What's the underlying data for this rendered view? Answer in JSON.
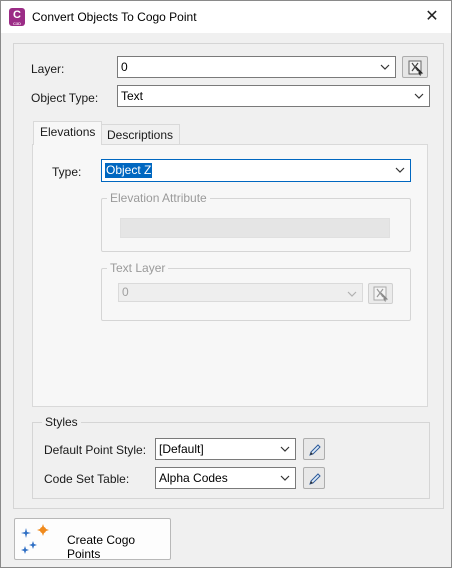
{
  "window": {
    "title": "Convert Objects To Cogo Point",
    "app_icon_letter": "C",
    "app_icon_sub": "C3D",
    "close_glyph": "✕"
  },
  "fields": {
    "layer_label": "Layer:",
    "layer_value": "0",
    "object_type_label": "Object Type:",
    "object_type_value": "Text"
  },
  "tabs": [
    {
      "label": "Elevations",
      "active": true
    },
    {
      "label": "Descriptions",
      "active": false
    }
  ],
  "elevations": {
    "type_label": "Type:",
    "type_value": "Object Z",
    "elevation_attribute_title": "Elevation Attribute",
    "text_layer_title": "Text Layer",
    "text_layer_value": "0"
  },
  "styles": {
    "title": "Styles",
    "default_point_style_label": "Default Point Style:",
    "default_point_style_value": "[Default]",
    "code_set_table_label": "Code Set Table:",
    "code_set_table_value": "Alpha Codes"
  },
  "actions": {
    "create_label": "Create Cogo Points"
  },
  "colors": {
    "accent": "#0067c0",
    "app_icon": "#9b2c86"
  },
  "icons": [
    "select-object-icon",
    "edit-pencil-icon",
    "create-points-icon",
    "close-icon",
    "chevron-down-icon"
  ]
}
